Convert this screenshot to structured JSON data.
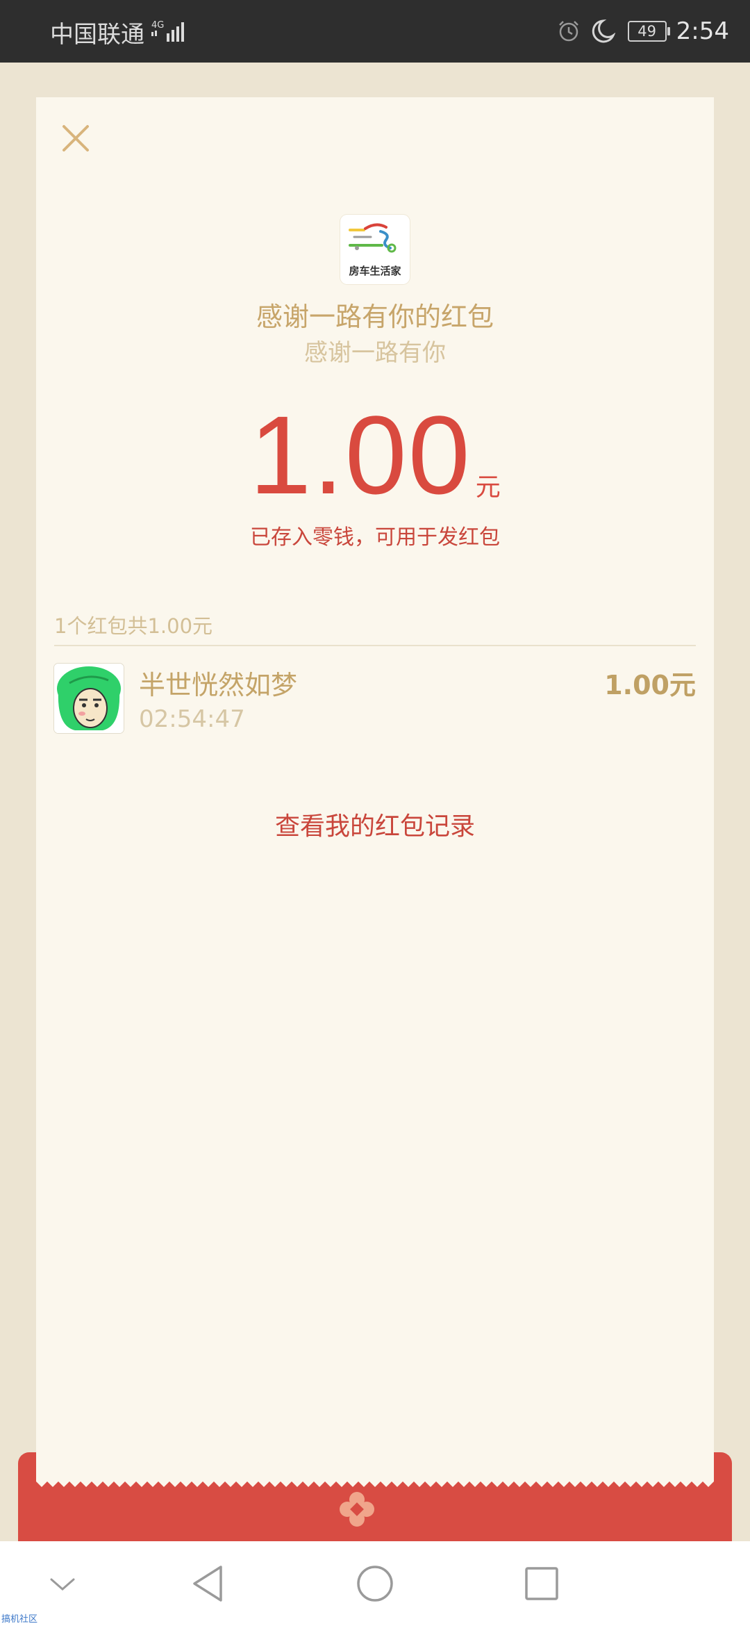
{
  "status_bar": {
    "carrier": "中国联通",
    "network": "4G",
    "battery_level": "49",
    "time": "2:54"
  },
  "packet": {
    "logo_text": "房车生活家",
    "title": "感谢一路有你的红包",
    "subtitle": "感谢一路有你",
    "amount": "1.00",
    "amount_unit": "元",
    "stored_note": "已存入零钱，可用于发红包",
    "summary": "1个红包共1.00元"
  },
  "records": [
    {
      "name": "半世恍然如梦",
      "time": "02:54:47",
      "amount": "1.00元"
    }
  ],
  "actions": {
    "view_history": "查看我的红包记录"
  },
  "watermark": "搞机社区",
  "colors": {
    "accent_red": "#d94a3f",
    "gold_text": "#c7a56a",
    "card_bg": "#fbf7ed",
    "page_bg": "#ece4d2"
  },
  "icons": {
    "close": "close-icon",
    "alarm": "alarm-icon",
    "moon": "do-not-disturb-icon",
    "signal": "signal-icon",
    "back": "back-triangle-icon",
    "home": "home-circle-icon",
    "recents": "recents-square-icon",
    "collapse": "chevron-down-icon"
  }
}
